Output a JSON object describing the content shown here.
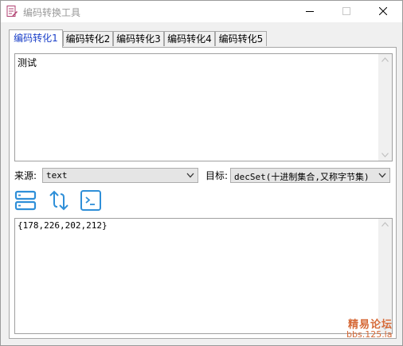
{
  "window": {
    "title": "编码转换工具",
    "app_icon": "document-pen-icon"
  },
  "tabs": [
    {
      "label": "编码转化1",
      "active": true
    },
    {
      "label": "编码转化2",
      "active": false
    },
    {
      "label": "编码转化3",
      "active": false
    },
    {
      "label": "编码转化4",
      "active": false
    },
    {
      "label": "编码转化5",
      "active": false
    }
  ],
  "input": {
    "value": "测试"
  },
  "source": {
    "label": "来源:",
    "selected": "text"
  },
  "target": {
    "label": "目标:",
    "selected": "decSet(十进制集合,又称字节集)"
  },
  "toolbar": {
    "buttons": [
      {
        "icon": "stack-icon"
      },
      {
        "icon": "swap-arrows-icon"
      },
      {
        "icon": "terminal-icon"
      }
    ]
  },
  "output": {
    "value": "{178,226,202,212}"
  },
  "watermark": {
    "text": "精易论坛",
    "url": "bbs.125.la"
  },
  "colors": {
    "accent": "#2f8fd8",
    "active_tab": "#1a3fc8",
    "watermark": "#d66a38"
  }
}
